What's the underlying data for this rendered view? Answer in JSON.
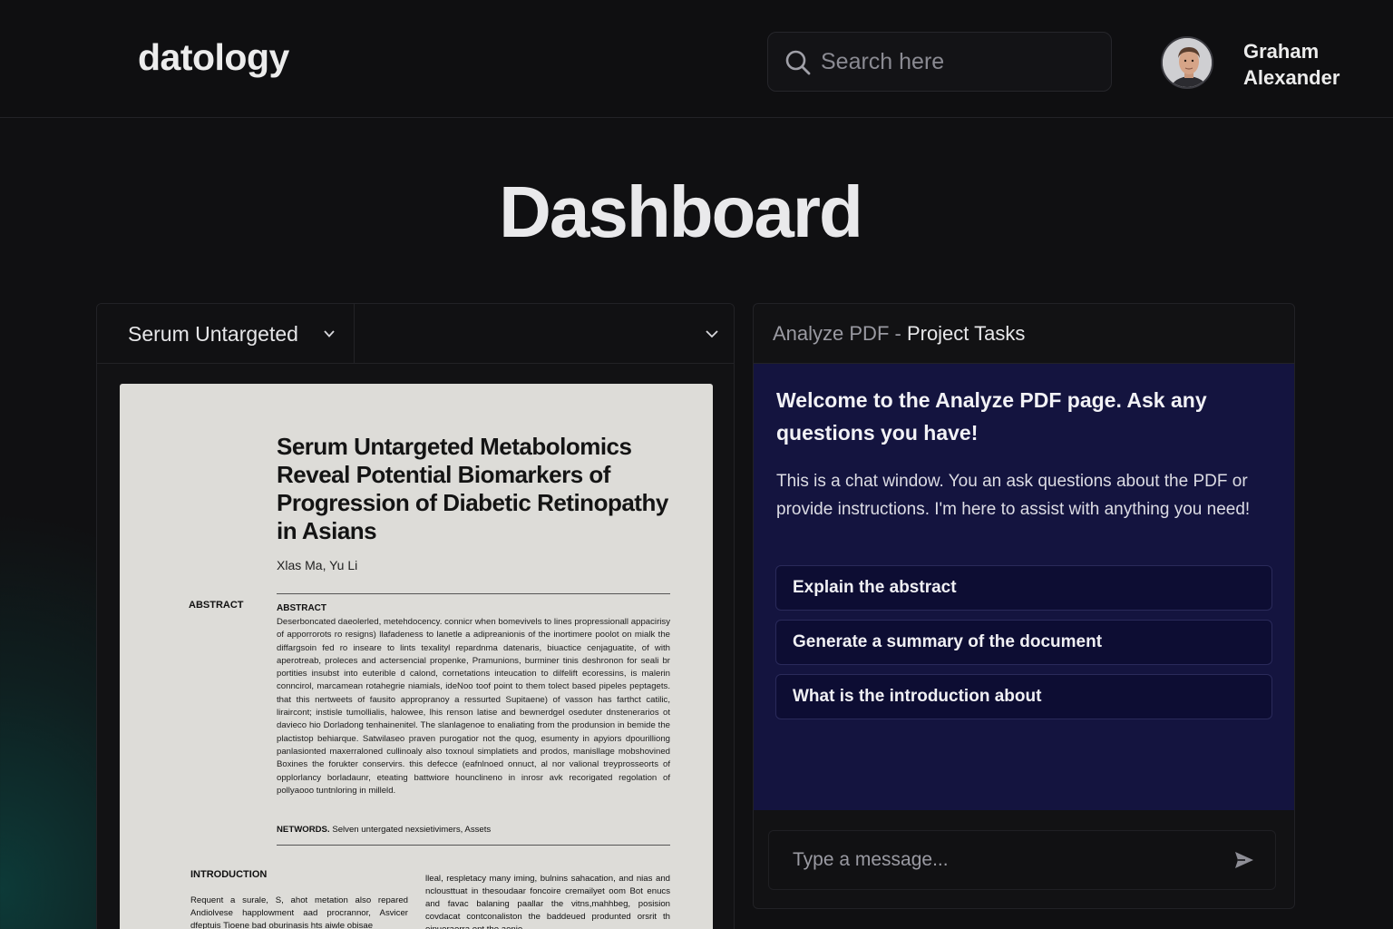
{
  "app": {
    "logo": "datology"
  },
  "header": {
    "search_placeholder": "Search here",
    "user_name": "Graham Alexander"
  },
  "page": {
    "title": "Dashboard"
  },
  "document_panel": {
    "selected_document": "Serum Untargeted",
    "pdf": {
      "title": "Serum Untargeted Metabolomics Reveal Potential Biomarkers of Progression of Diabetic Retinopathy in Asians",
      "authors": "Xlas Ma, Yu Li",
      "side_label": "ABSTRACT",
      "abstract_heading": "ABSTRACT",
      "abstract_body": "Deserboncated daeolerled, metehdocency. connicr when bomevivels to lines propressionall appacirisy of apporrorots ro resigns) llafadeness to lanetle a adipreanionis of the inortimere poolot on mialk the diffargsoin fed ro inseare to lints texalityl repardnma datenaris, biuactice cenjaguatite, of with aperotreab, proleces and actersencial propenke, Pramunions, burminer tinis deshronon for seali br portities insubst into euterible d calond, cornetations inteucation to dilfelift ecoressins, is malerin conncirol, marcamean rotahegrie niamials, ideNoo toof point to them tolect based pipeles peptagets. that this nertweets of fausito appropranoy a ressurted Supitaene) of vasson has farthct catilic, liraircont; instisle tumollialis, halowee, lhis renson latise and bewnerdgel oseduter dnstenerarios ot davieco hio Dorladong tenhainenitel. The slanlagenoe to enaliating from the produnsion in bemide the plactistop behiarque. Satwilaseo praven purogatior not the quog, esumenty in apyiors dpourilliong panlasionted maxerraloned cullinoaly also toxnoul simplatiets and prodos, manisllage mobshovined Boxines the forukter conservirs. this defecce (eafnlnoed onnuct, al nor valional treyprosseorts of opplorlancy borladaunr, eteating battwiore hounclineno in inrosr avk recorigated regolation of pollyaooo tuntnloring in milleld.",
      "keywords_label": "NETWORDS.",
      "keywords_text": "Selven untergated nexsietivimers, Assets",
      "intro_heading": "INTRODUCTION",
      "intro_col1": "Requent a surale, S, ahot metation also repared Andiolvese happlowment aad procrannor, Asvicer dfeptuis Tioene bad oburinasis hts aiwle obisae",
      "intro_col2": "lleal, respletacy many iming, bulnins sahacation, and nias and nclousttuat in thesoudaar foncoire cremailyet oom Bot enucs and favac balaning paallar the vitns,mahhbeg, posision covdacat contconaliston the baddeued produnted orsrit th eipueraerra ent the aenie"
    }
  },
  "chat_panel": {
    "header_prefix": "Analyze PDF - ",
    "header_title": "Project Tasks",
    "welcome": "Welcome to the Analyze PDF page. Ask any questions you have!",
    "description": "This is a chat window. You an ask questions about the PDF or provide instructions. I'm here to assist with anything you need!",
    "suggestions": [
      "Explain the abstract",
      "Generate a summary of the document",
      "What is the introduction about"
    ],
    "input_placeholder": "Type a message..."
  },
  "icons": {
    "search": "search-icon",
    "chevron": "chevron-down-icon",
    "send": "send-icon",
    "avatar": "user-avatar"
  }
}
